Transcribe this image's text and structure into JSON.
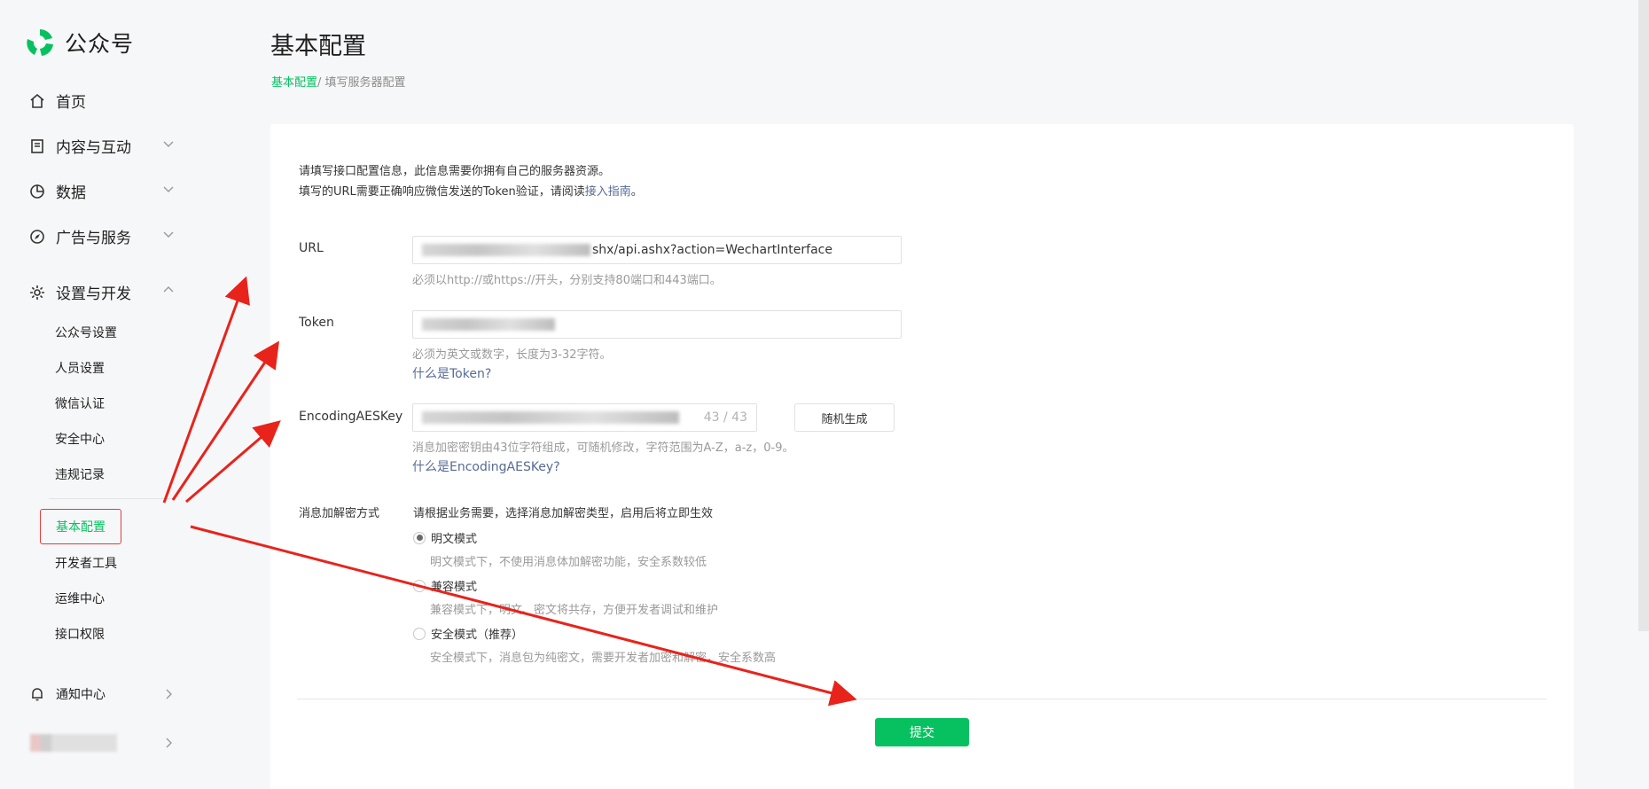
{
  "brand": {
    "name": "公众号"
  },
  "sidebar": {
    "home": "首页",
    "content": "内容与互动",
    "data": "数据",
    "ads": "广告与服务",
    "settings": "设置与开发",
    "sub_items": [
      "公众号设置",
      "人员设置",
      "微信认证",
      "安全中心",
      "违规记录"
    ],
    "active_item": "基本配置",
    "dev_items": [
      "开发者工具",
      "运维中心",
      "接口权限"
    ],
    "notify": "通知中心"
  },
  "page": {
    "title": "基本配置",
    "breadcrumb_link": "基本配置",
    "breadcrumb_rest": "/ 填写服务器配置"
  },
  "intro": {
    "line1": "请填写接口配置信息，此信息需要你拥有自己的服务器资源。",
    "line2_pre": "填写的URL需要正确响应微信发送的Token验证，请阅读",
    "line2_link": "接入指南",
    "line2_post": "。"
  },
  "form": {
    "url_label": "URL",
    "url_value_visible": "shx/api.ashx?action=WechartInterface",
    "url_hint": "必须以http://或https://开头，分别支持80端口和443端口。",
    "token_label": "Token",
    "token_hint": "必须为英文或数字，长度为3-32字符。",
    "token_help": "什么是Token?",
    "aes_label": "EncodingAESKey",
    "aes_counter": "43 / 43",
    "aes_generate": "随机生成",
    "aes_hint": "消息加密密钥由43位字符组成，可随机修改，字符范围为A-Z，a-z，0-9。",
    "aes_help": "什么是EncodingAESKey?",
    "mode_label": "消息加解密方式",
    "mode_intro": "请根据业务需要，选择消息加解密类型，启用后将立即生效",
    "modes": [
      {
        "label": "明文模式",
        "desc": "明文模式下，不使用消息体加解密功能，安全系数较低",
        "selected": true
      },
      {
        "label": "兼容模式",
        "desc": "兼容模式下，明文、密文将共存，方便开发者调试和维护",
        "selected": false
      },
      {
        "label": "安全模式（推荐）",
        "desc": "安全模式下，消息包为纯密文，需要开发者加密和解密，安全系数高",
        "selected": false
      }
    ],
    "submit": "提交"
  },
  "colors": {
    "accent": "#07c160",
    "link": "#576b95",
    "annotation": "#e8231b"
  }
}
